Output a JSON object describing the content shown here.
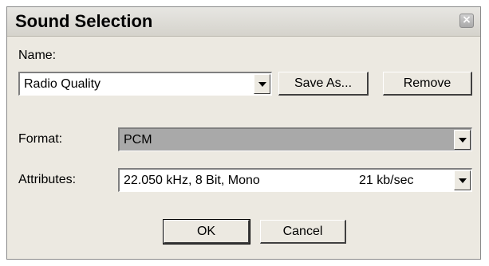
{
  "dialog": {
    "title": "Sound Selection",
    "close_glyph": "×",
    "name_label": "Name:",
    "name_value": "Radio Quality",
    "save_as_label": "Save As...",
    "remove_label": "Remove",
    "format_label": "Format:",
    "format_value": "PCM",
    "attributes_label": "Attributes:",
    "attributes_value": "22.050 kHz, 8 Bit, Mono",
    "attributes_rate": "21 kb/sec",
    "ok_label": "OK",
    "cancel_label": "Cancel"
  },
  "icons": [
    "close-icon",
    "dropdown-arrow-icon"
  ],
  "colors": {
    "dialog_bg": "#ece9e1",
    "disabled_field_bg": "#a9a9a9"
  }
}
